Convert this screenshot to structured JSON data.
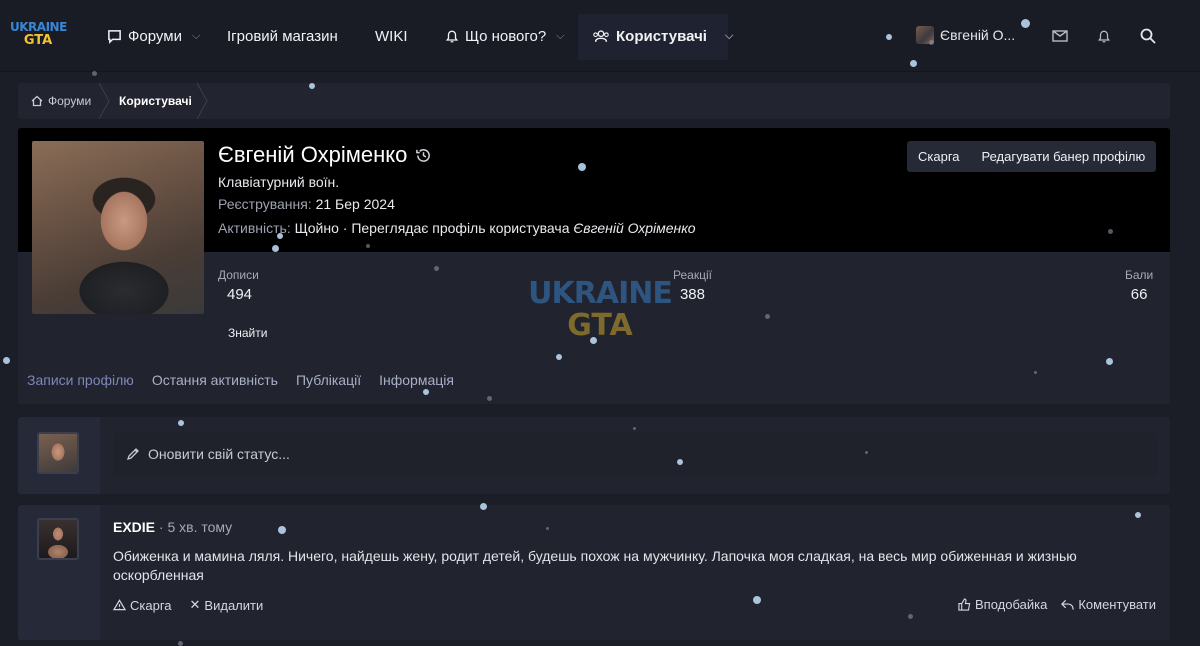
{
  "logo": {
    "line1": "UKRAINE",
    "line2": "GTA"
  },
  "nav": {
    "forums": "Форуми",
    "shop": "Ігровий магазин",
    "wiki": "WIKI",
    "whats_new": "Що нового?",
    "users": "Користувачі",
    "user_name": "Євгеній О..."
  },
  "breadcrumb": {
    "home": "Форуми",
    "current": "Користувачі"
  },
  "profile": {
    "name": "Євгеній Охріменко",
    "title": "Клавіатурний воїн.",
    "registered_label": "Реєстрування:",
    "registered_value": "21 Бер 2024",
    "activity_label": "Активність:",
    "activity_value": "Щойно · Переглядає профіль користувача",
    "activity_user": "Євгеній Охріменко",
    "report_button": "Скарга",
    "edit_banner_button": "Редагувати банер профілю",
    "stats": {
      "posts_label": "Дописи",
      "posts_value": "494",
      "reactions_label": "Реакції",
      "reactions_value": "388",
      "points_label": "Бали",
      "points_value": "66"
    },
    "find_button": "Знайти",
    "tabs": [
      "Записи профілю",
      "Остання активність",
      "Публікації",
      "Інформація"
    ]
  },
  "status": {
    "placeholder": "Оновити свій статус..."
  },
  "post": {
    "author": "EXDIE",
    "time": "· 5 хв. тому",
    "body": "Обиженка и мамина ляля. Ничего, найдешь жену, родит детей, будешь похож на мужчинку. Лапочка моя сладкая, на весь мир обиженная и жизнью оскорбленная",
    "report": "Скарга",
    "delete": "Видалити",
    "like": "Вподобайка",
    "comment": "Коментувати"
  },
  "watermark": {
    "line1": "UKRAINE",
    "line2": "GTA"
  },
  "colors": {
    "background": "#1c1e27",
    "panel": "#21232e",
    "banner": "#000000",
    "tab_active": "#7f86b8"
  }
}
